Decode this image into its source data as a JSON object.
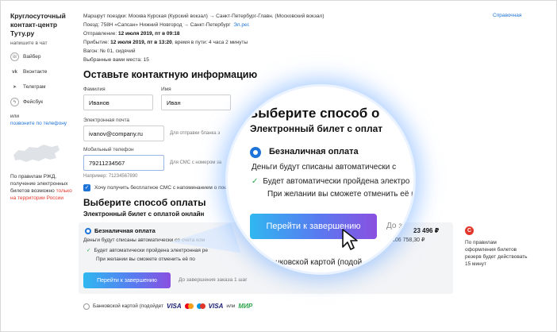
{
  "sidebar": {
    "title": "Круглосуточный контакт-центр Туту.ру",
    "subtitle": "напишите в чат",
    "channels": [
      "Вайбер",
      "Вконтакте",
      "Телеграм",
      "Фейсбук"
    ],
    "or_label": "или",
    "call_link": "позвоните по телефону",
    "note_prefix": "По правилам РЖД, получение электронных билетов возможно",
    "note_link": "только на территории России"
  },
  "route": {
    "line1": "Маршрут поездки: Москва Курская (Курский вокзал) → Санкт-Петербург-Главн. (Московский вокзал)",
    "line2_text": "Поезд: 758Н «Сапсан» Нижний Новгород → Санкт-Петербург",
    "line2_link": "Эл.рег.",
    "line3_label": "Отправление:",
    "line3_value": "12 июля 2019, пт в 09:18",
    "line4_label": "Прибытие:",
    "line4_value": "12 июля 2019, пт в 13:20",
    "line4_rest": ", время в пути: 4 часа 2 минуты",
    "line5": "Вагон: № 01, сидячий",
    "line6": "Выбранные вами места: 15",
    "help_link": "Справочная"
  },
  "contact": {
    "heading": "Оставьте контактную информацию",
    "surname_label": "Фамилия",
    "surname_value": "Иванов",
    "name_label": "Имя",
    "name_value": "Иван",
    "email_label": "Электронная почта",
    "email_value": "ivanov@company.ru",
    "email_hint": "Для отправки бланка э",
    "phone_label": "Мобильный телефон",
    "phone_value": "79211234567",
    "phone_hint": "Для СМС с номером за",
    "phone_example": "Например: 71234567890",
    "sms_checkbox": "Хочу получить бесплатное СМС с напоминанием о поез"
  },
  "payment": {
    "heading": "Выберите способ оплаты",
    "sub": "Электронный билет с оплатой онлайн",
    "cashless_title": "Безналичная оплата",
    "cashless_text": "Деньги будут списаны автоматически со счета ком",
    "check1": "Будет автоматически пройдена электронная ре",
    "check2": "При желании вы сможете отменить её по",
    "price_main": "23 496 ₽",
    "price_sub": "106 758,30 ₽",
    "finish_button": "Перейти к завершению",
    "to_finish": "До завершения заказа 1 шаг",
    "card_option": "Банковской картой (подойдет",
    "card_or": "или",
    "visa1": "VISA",
    "visa2": "VISA",
    "mir": "МИР",
    "warn_icon": "С",
    "warn_text": "По правилам оформления билетов резерв будет действовать 15 минут"
  },
  "magnifier": {
    "heading": "Выберите способ о",
    "sub": "Электронный билет с оплат",
    "title": "Безналичная оплата",
    "text": "Деньги будут списаны автоматически с",
    "check1": "Будет автоматически пройдена электро",
    "check2": "При желании вы сможете отменить её п",
    "button": "Перейти к завершению",
    "to_finish": "До за",
    "card": "Банковской картой (подой"
  },
  "colors": {
    "accent": "#1e73d8",
    "warn": "#e3362b",
    "check": "#2aa84a"
  }
}
